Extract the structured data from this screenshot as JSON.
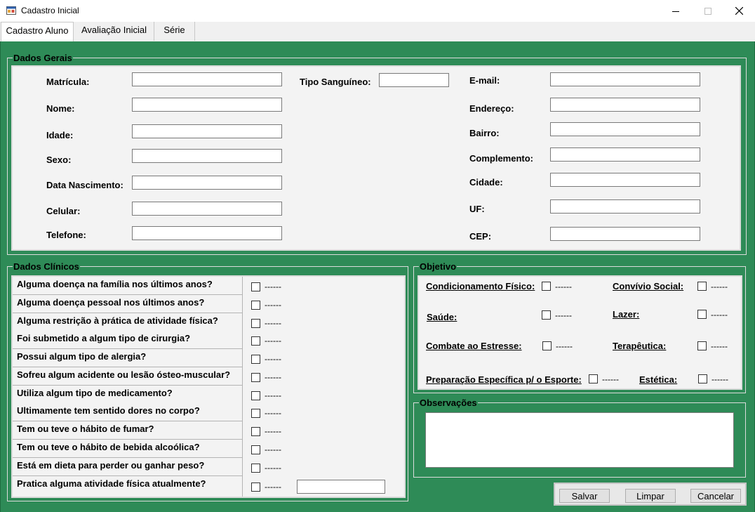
{
  "window": {
    "title": "Cadastro Inicial"
  },
  "tabs": [
    {
      "label": "Cadastro Aluno"
    },
    {
      "label": "Avaliação Inicial"
    },
    {
      "label": "Série"
    }
  ],
  "dados_gerais": {
    "title": "Dados Gerais",
    "left_fields": [
      {
        "label": "Matrícula:",
        "value": ""
      },
      {
        "label": "Nome:",
        "value": ""
      },
      {
        "label": "Idade:",
        "value": ""
      },
      {
        "label": "Sexo:",
        "value": ""
      },
      {
        "label": "Data Nascimento:",
        "value": ""
      },
      {
        "label": "Celular:",
        "value": ""
      },
      {
        "label": "Telefone:",
        "value": ""
      }
    ],
    "tipo_sanguineo": {
      "label": "Tipo Sanguíneo:",
      "value": ""
    },
    "right_fields": [
      {
        "label": "E-mail:",
        "value": ""
      },
      {
        "label": "Endereço:",
        "value": ""
      },
      {
        "label": "Bairro:",
        "value": ""
      },
      {
        "label": "Complemento:",
        "value": ""
      },
      {
        "label": "Cidade:",
        "value": ""
      },
      {
        "label": "UF:",
        "value": ""
      },
      {
        "label": "CEP:",
        "value": ""
      }
    ]
  },
  "dados_clinicos": {
    "title": "Dados Clínicos",
    "questions": [
      {
        "text": "Alguma doença na família nos últimos anos?",
        "detail": "------"
      },
      {
        "text": "Alguma doença pessoal nos últimos anos?",
        "detail": "------"
      },
      {
        "text": "Alguma restrição à prática de atividade física?",
        "detail": "------"
      },
      {
        "text": "Foi submetido a algum tipo de cirurgia?",
        "detail": "------"
      },
      {
        "text": "Possui algum tipo de alergia?",
        "detail": "------"
      },
      {
        "text": "Sofreu algum acidente ou lesão ósteo-muscular?",
        "detail": "------"
      },
      {
        "text": "Utiliza algum tipo de medicamento?",
        "detail": "------"
      },
      {
        "text": "Ultimamente tem sentido dores no corpo?",
        "detail": "------"
      },
      {
        "text": "Tem ou teve o hábito de fumar?",
        "detail": "------"
      },
      {
        "text": "Tem ou teve o hábito de bebida alcoólica?",
        "detail": "------"
      },
      {
        "text": "Está em dieta para perder ou ganhar peso?",
        "detail": "------"
      },
      {
        "text": "Pratica alguma atividade física atualmente?",
        "detail": "------"
      }
    ],
    "atividade_input": ""
  },
  "objetivo": {
    "title": "Objetivo",
    "items": [
      {
        "label": "Condicionamento Físico:",
        "detail": "------"
      },
      {
        "label": "Convívio Social:",
        "detail": "------"
      },
      {
        "label": "Saúde:",
        "detail": "------"
      },
      {
        "label": "Lazer:",
        "detail": "------"
      },
      {
        "label": "Combate ao Estresse:",
        "detail": "------"
      },
      {
        "label": "Terapêutica:",
        "detail": "------"
      },
      {
        "label": "Preparação Específica p/ o Esporte:",
        "detail": "------"
      },
      {
        "label": "Estética:",
        "detail": "------"
      }
    ]
  },
  "observacoes": {
    "title": "Observações",
    "value": ""
  },
  "buttons": {
    "save": "Salvar",
    "clear": "Limpar",
    "cancel": "Cancelar"
  },
  "colors": {
    "background": "#2e8b57",
    "panel": "#f3f3f3"
  }
}
